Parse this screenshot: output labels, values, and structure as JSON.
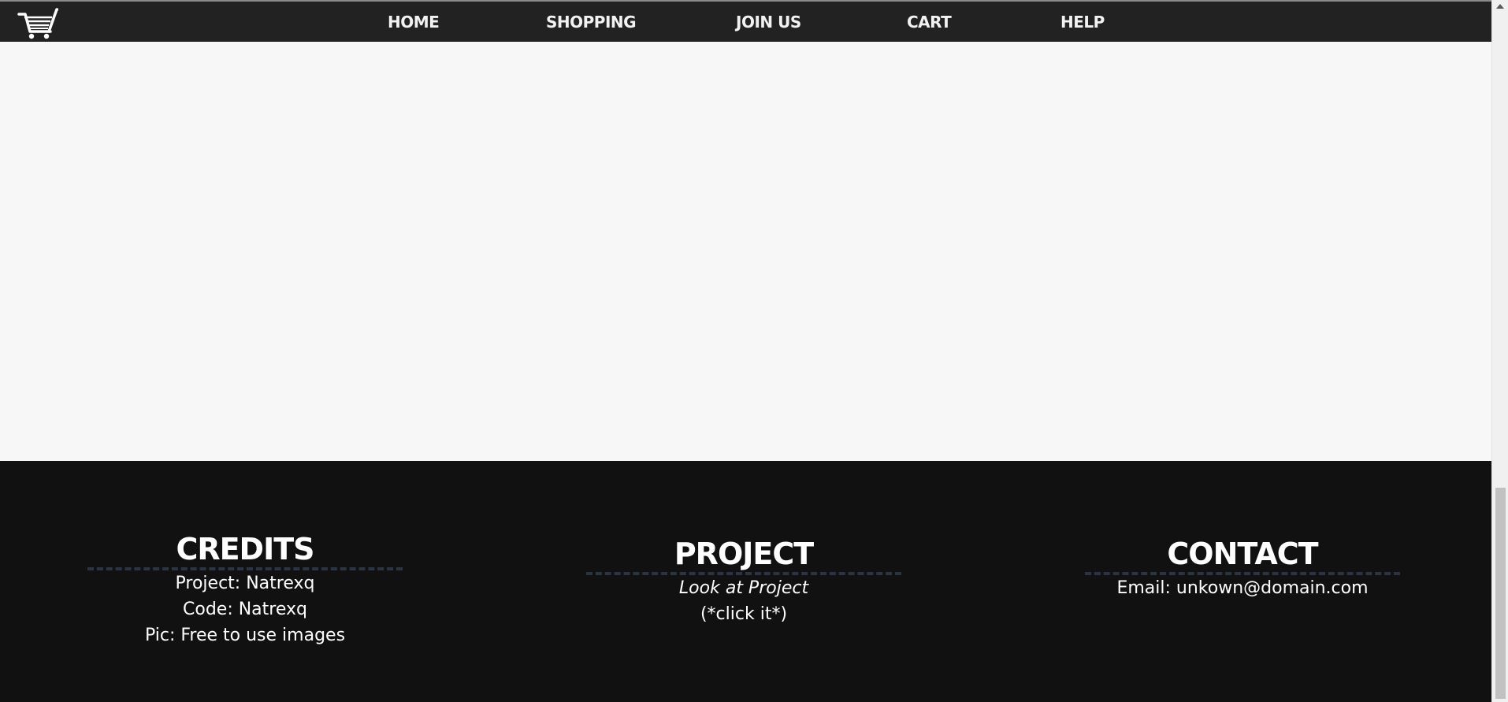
{
  "navbar": {
    "logo_icon": "shopping-cart-icon",
    "items": [
      {
        "label": "HOME"
      },
      {
        "label": "SHOPPING"
      },
      {
        "label": "JOIN US"
      },
      {
        "label": "CART"
      },
      {
        "label": "HELP"
      }
    ]
  },
  "footer": {
    "credits": {
      "title": "CREDITS",
      "lines": [
        "Project: Natrexq",
        "Code: Natrexq",
        "Pic: Free to use images"
      ]
    },
    "project": {
      "title": "PROJECT",
      "link": "Look at Project",
      "hint": "(*click it*)"
    },
    "contact": {
      "title": "CONTACT",
      "email": "Email: unkown@domain.com"
    }
  },
  "colors": {
    "navbar_bg": "#222222",
    "page_bg": "#f7f7f7",
    "footer_bg": "#111111",
    "divider": "#2b3443",
    "text": "#ffffff"
  }
}
